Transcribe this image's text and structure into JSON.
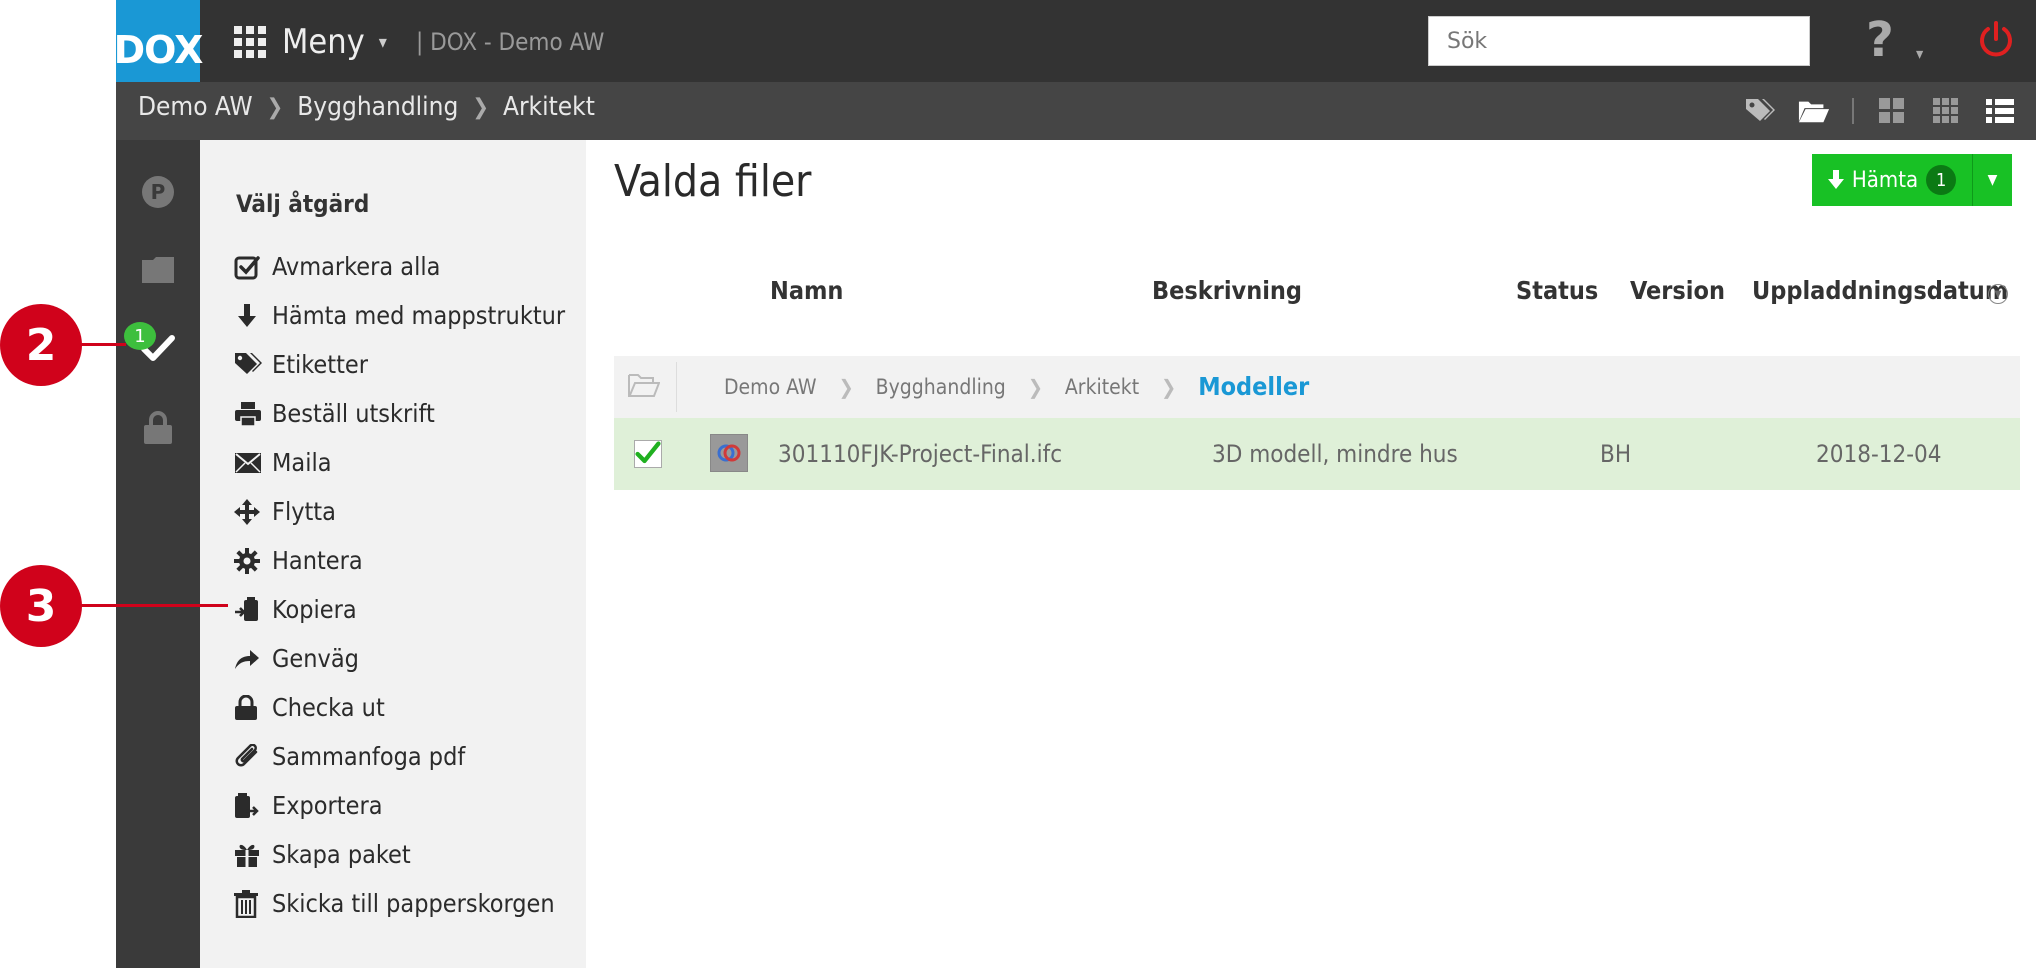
{
  "app": {
    "logo": "DOX",
    "menu_label": "Meny",
    "context": "| DOX - Demo AW",
    "search_placeholder": "Sök"
  },
  "breadcrumb": [
    "Demo AW",
    "Bygghandling",
    "Arkitekt"
  ],
  "rail": {
    "badge_count": "1",
    "items": [
      "p-icon",
      "folder-icon",
      "checkmark-icon",
      "lock-icon"
    ]
  },
  "actions": {
    "title": "Välj åtgärd",
    "items": [
      {
        "label": "Avmarkera alla",
        "icon": "checkbox-icon"
      },
      {
        "label": "Hämta med mappstruktur",
        "icon": "download-icon"
      },
      {
        "label": "Etiketter",
        "icon": "tags-icon"
      },
      {
        "label": "Beställ utskrift",
        "icon": "print-icon"
      },
      {
        "label": "Maila",
        "icon": "mail-icon"
      },
      {
        "label": "Flytta",
        "icon": "move-icon"
      },
      {
        "label": "Hantera",
        "icon": "gear-icon"
      },
      {
        "label": "Kopiera",
        "icon": "copy-icon"
      },
      {
        "label": "Genväg",
        "icon": "share-icon"
      },
      {
        "label": "Checka ut",
        "icon": "lock-icon"
      },
      {
        "label": "Sammanfoga pdf",
        "icon": "paperclip-icon"
      },
      {
        "label": "Exportera",
        "icon": "export-icon"
      },
      {
        "label": "Skapa paket",
        "icon": "gift-icon"
      },
      {
        "label": "Skicka till papperskorgen",
        "icon": "trash-icon"
      }
    ]
  },
  "markers": [
    "2",
    "3"
  ],
  "main": {
    "title": "Valda filer",
    "download_label": "Hämta",
    "download_count": "1",
    "columns": {
      "name": "Namn",
      "description": "Beskrivning",
      "status": "Status",
      "version": "Version",
      "upload_date": "Uppladdningsdatum"
    },
    "path": [
      "Demo AW",
      "Bygghandling",
      "Arkitekt"
    ],
    "path_current": "Modeller",
    "files": [
      {
        "name": "301110FJK-Project-Final.ifc",
        "description": "3D modell, mindre hus",
        "status": "BH",
        "version": "",
        "upload_date": "2018-12-04",
        "selected": true
      }
    ]
  },
  "colors": {
    "accent_blue": "#1a98d5",
    "download_green": "#18c125",
    "marker_red": "#d0021b",
    "selected_row": "#dff0d8",
    "topbar": "#333333"
  }
}
